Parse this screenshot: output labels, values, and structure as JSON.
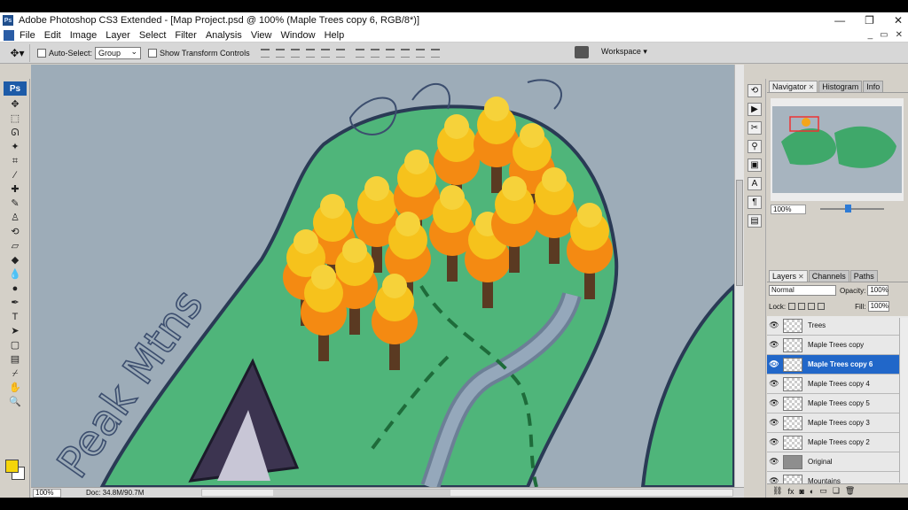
{
  "app": {
    "logo": "Ps",
    "title": "Adobe Photoshop CS3 Extended - [Map Project.psd @ 100% (Maple Trees copy 6, RGB/8*)]",
    "window_controls": [
      "minimize-icon",
      "restore-icon",
      "close-icon"
    ]
  },
  "menu": [
    "File",
    "Edit",
    "Image",
    "Layer",
    "Select",
    "Filter",
    "Analysis",
    "View",
    "Window",
    "Help"
  ],
  "options": {
    "auto_select_label": "Auto-Select:",
    "auto_select_value": "Group",
    "transform_label": "Show Transform Controls",
    "workspace_label": "Workspace ▾"
  },
  "toolbox": {
    "badge": "Ps",
    "tools": [
      "move-icon",
      "marquee-icon",
      "lasso-icon",
      "magic-wand-icon",
      "crop-icon",
      "eyedropper-icon",
      "healing-icon",
      "brush-icon",
      "clone-stamp-icon",
      "history-brush-icon",
      "eraser-icon",
      "paint-bucket-icon",
      "blur-icon",
      "dodge-icon",
      "pen-icon",
      "type-icon",
      "path-select-icon",
      "shape-icon",
      "notes-icon",
      "eyedrop2-icon",
      "hand-icon",
      "zoom-icon"
    ],
    "foreground_color": "#f5d50a",
    "background_color": "#ffffff"
  },
  "canvas": {
    "labels": [
      "Peak Mtns"
    ]
  },
  "status": {
    "zoom": "100%",
    "doc": "Doc: 34.8M/90.7M"
  },
  "navigator": {
    "tabs": [
      "Navigator",
      "Histogram",
      "Info"
    ],
    "zoom": "100%"
  },
  "layers": {
    "tabs": [
      "Layers",
      "Channels",
      "Paths"
    ],
    "blend_mode": "Normal",
    "opacity_label": "Opacity:",
    "opacity": "100%",
    "lock_label": "Lock:",
    "fill_label": "Fill:",
    "fill": "100%",
    "items": [
      {
        "name": "Trees",
        "selected": false,
        "thumb": "checker"
      },
      {
        "name": "Maple Trees copy",
        "selected": false,
        "thumb": "checker"
      },
      {
        "name": "Maple Trees copy 6",
        "selected": true,
        "thumb": "checker"
      },
      {
        "name": "Maple Trees copy 4",
        "selected": false,
        "thumb": "checker"
      },
      {
        "name": "Maple Trees copy 5",
        "selected": false,
        "thumb": "checker"
      },
      {
        "name": "Maple Trees copy 3",
        "selected": false,
        "thumb": "checker"
      },
      {
        "name": "Maple Trees copy 2",
        "selected": false,
        "thumb": "checker"
      },
      {
        "name": "Original",
        "selected": false,
        "thumb": "gray"
      },
      {
        "name": "Mountains",
        "selected": false,
        "thumb": "checker"
      }
    ],
    "footer_icons": [
      "link-icon",
      "fx-icon",
      "mask-icon",
      "adjustment-icon",
      "group-icon",
      "new-layer-icon",
      "trash-icon"
    ]
  }
}
